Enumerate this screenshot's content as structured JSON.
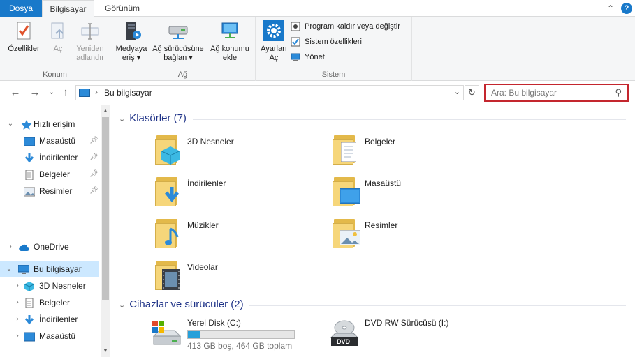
{
  "ribbon_tabs": {
    "file": "Dosya",
    "computer": "Bilgisayar",
    "view": "Görünüm"
  },
  "window": {
    "collapse_glyph": "⌃",
    "help_glyph": "?"
  },
  "ribbon": {
    "location_group": {
      "label": "Konum",
      "properties": "Özellikler",
      "open": "Aç",
      "rename": [
        "Yeniden",
        "adlandır"
      ]
    },
    "network_group": {
      "label": "Ağ",
      "media_access": [
        "Medyaya",
        "eriş"
      ],
      "map_drive": [
        "Ağ sürücüsüne",
        "bağlan"
      ],
      "add_location": [
        "Ağ konumu",
        "ekle"
      ]
    },
    "system_group": {
      "label": "Sistem",
      "open_settings": [
        "Ayarları",
        "Aç"
      ],
      "uninstall": "Program kaldır veya değiştir",
      "system_properties": "Sistem özellikleri",
      "manage": "Yönet"
    }
  },
  "address": {
    "path": "Bu bilgisayar",
    "search_placeholder": "Ara: Bu bilgisayar"
  },
  "nav_pane": {
    "quick_access": "Hızlı erişim",
    "quick_items": [
      "Masaüstü",
      "İndirilenler",
      "Belgeler",
      "Resimler"
    ],
    "onedrive": "OneDrive",
    "this_pc": "Bu bilgisayar",
    "pc_items": [
      "3D Nesneler",
      "Belgeler",
      "İndirilenler",
      "Masaüstü"
    ]
  },
  "content": {
    "folders_header": "Klasörler (7)",
    "folders": [
      "3D Nesneler",
      "Belgeler",
      "İndirilenler",
      "Masaüstü",
      "Müzikler",
      "Resimler",
      "Videolar"
    ],
    "devices_header": "Cihazlar ve sürücüler (2)",
    "local_disk": {
      "name": "Yerel Disk (C:)",
      "status": "413 GB boş, 464 GB toplam",
      "used_fraction": 0.11
    },
    "dvd": {
      "name": "DVD RW Sürücüsü (I:)",
      "badge": "DVD"
    }
  },
  "colors": {
    "accent": "#1979ca",
    "search_highlight": "#c4262e",
    "selection": "#cce8ff",
    "header_text": "#1e3287"
  }
}
